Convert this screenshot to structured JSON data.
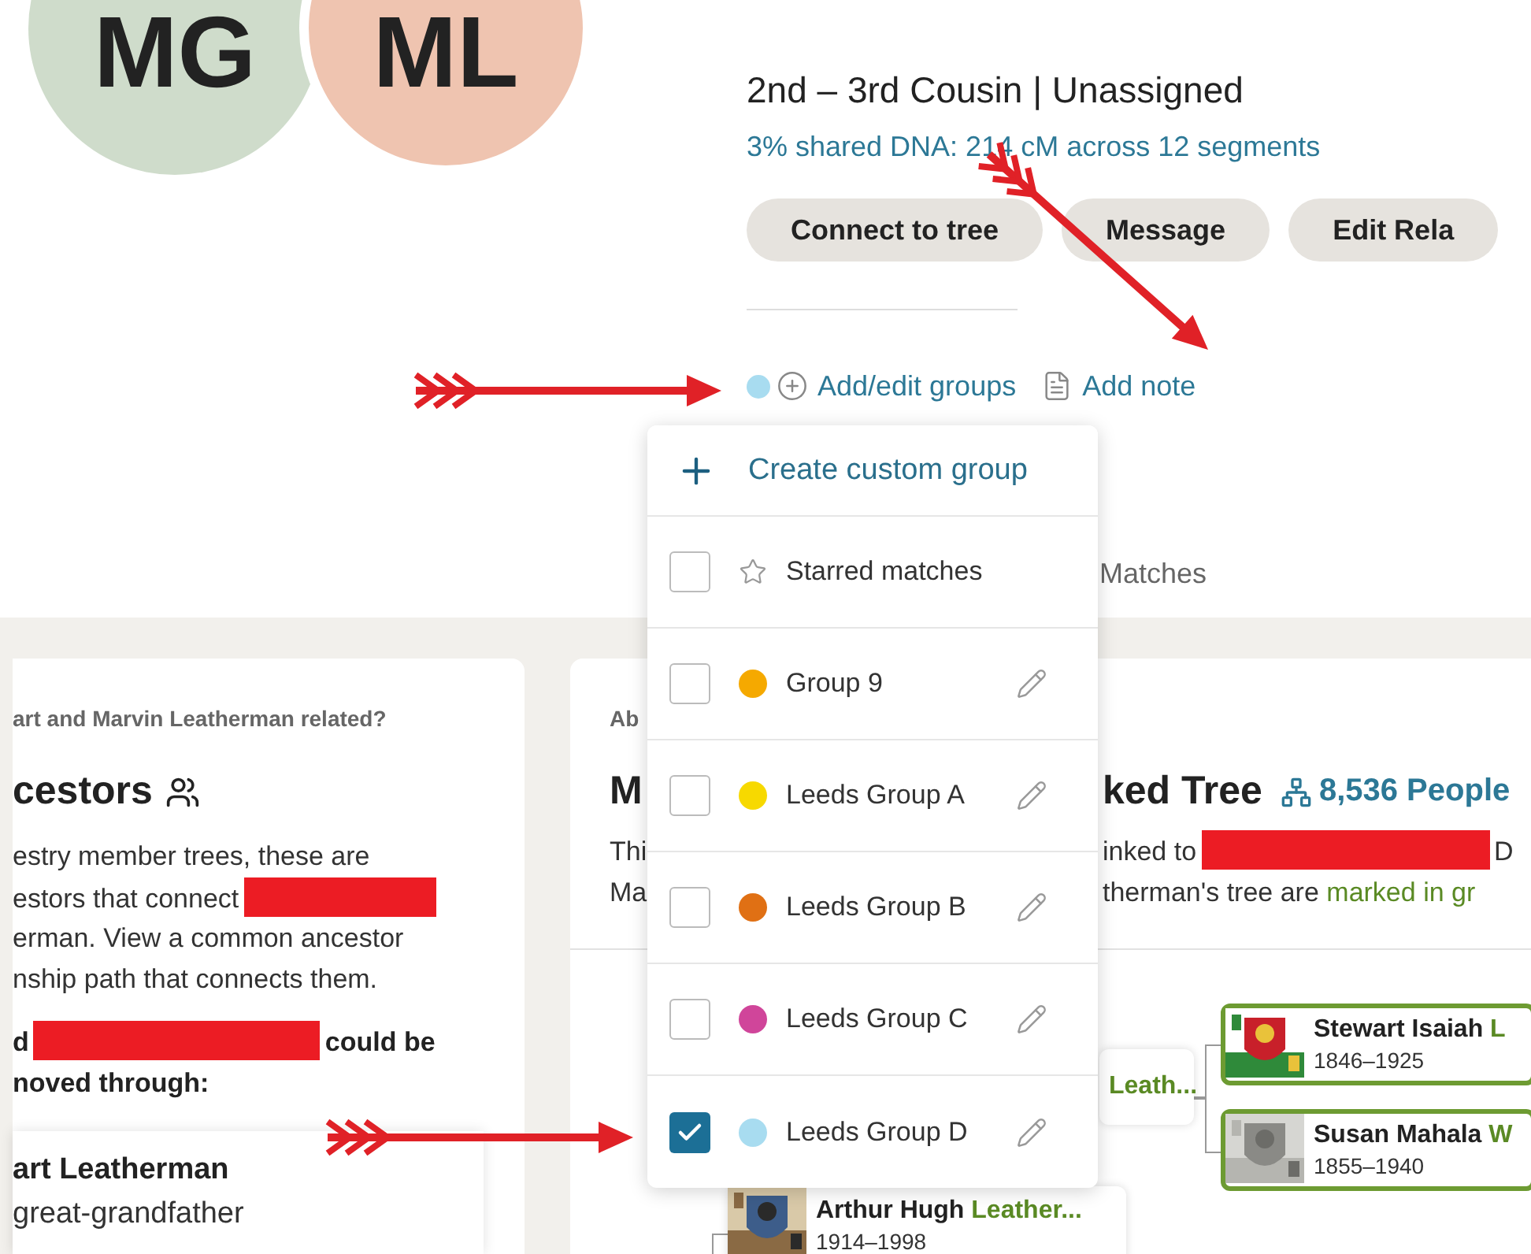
{
  "avatars": [
    {
      "initials": "MG",
      "color": "#cfdccb"
    },
    {
      "initials": "ML",
      "color": "#efc4b0"
    }
  ],
  "match": {
    "relationship": "2nd – 3rd Cousin | Unassigned",
    "shared_dna": "3% shared DNA: 214 cM across 12 segments"
  },
  "actions": [
    "Connect to tree",
    "Message",
    "Edit Rela"
  ],
  "group_links": {
    "color": "#a8dcf0",
    "groups_label": "Add/edit groups",
    "note_label": "Add note"
  },
  "tabs": [
    {
      "label": "Matches",
      "selected": false
    }
  ],
  "ancestors_card": {
    "question": "art and Marvin Leatherman related?",
    "title": "cestors",
    "lines": [
      [
        {
          "kind": "text",
          "text": "estry member trees, these are"
        }
      ],
      [
        {
          "kind": "text",
          "text": "estors that connect"
        },
        {
          "kind": "redaction"
        }
      ],
      [
        {
          "kind": "text",
          "text": "erman. View a common ancestor"
        }
      ],
      [
        {
          "kind": "text",
          "text": "nship path that connects them."
        }
      ]
    ],
    "bold_lines": [
      [
        {
          "kind": "text",
          "text": "d"
        },
        {
          "kind": "redaction"
        },
        {
          "kind": "text",
          "text": "could be"
        }
      ],
      [
        {
          "kind": "text",
          "text": "noved through:"
        }
      ]
    ],
    "ancestor": {
      "name": "art Leatherman",
      "relation": "great-grandfather"
    }
  },
  "tree_card": {
    "eyebrow": "Ab",
    "title_start": "M",
    "title_end": "ked Tree",
    "people_count": "8,536 People",
    "desc_left": [
      "Thi",
      "Ma"
    ],
    "desc_right": [
      [
        {
          "kind": "text",
          "text": "inked to"
        },
        {
          "kind": "redaction"
        },
        {
          "kind": "text",
          "text": "D"
        }
      ],
      [
        {
          "kind": "text",
          "text": "therman's tree are "
        },
        {
          "kind": "highlight",
          "text": "marked in gr"
        }
      ]
    ],
    "nodes": [
      {
        "kind": "stub",
        "surname": "Leath..."
      },
      {
        "kind": "person",
        "name": "Stewart Isaiah ",
        "surname": "L",
        "dates": "1846–1925"
      },
      {
        "kind": "person",
        "name": "Susan Mahala ",
        "surname": "W",
        "dates": "1855–1940"
      },
      {
        "kind": "plain",
        "name": "Arthur Hugh ",
        "surname": "Leather...",
        "dates": "1914–1998"
      }
    ]
  },
  "dropdown": {
    "create_label": "Create custom group",
    "items": [
      {
        "kind": "starred",
        "label": "Starred matches",
        "checked": false
      },
      {
        "kind": "group",
        "label": "Group 9",
        "color": "#f5a900",
        "checked": false
      },
      {
        "kind": "group",
        "label": "Leeds Group A",
        "color": "#f7d900",
        "checked": false
      },
      {
        "kind": "group",
        "label": "Leeds Group B",
        "color": "#e07014",
        "checked": false
      },
      {
        "kind": "group",
        "label": "Leeds Group C",
        "color": "#d0459a",
        "checked": false
      },
      {
        "kind": "group",
        "label": "Leeds Group D",
        "color": "#a8dcf0",
        "checked": true
      }
    ]
  }
}
